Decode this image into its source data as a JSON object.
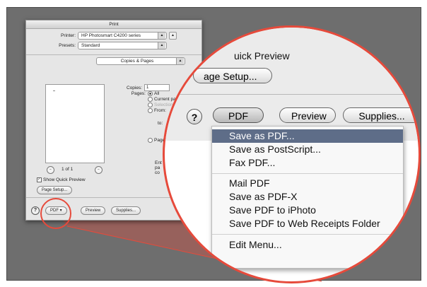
{
  "dialog": {
    "title": "Print",
    "printer_label": "Printer:",
    "printer_value": "HP Photosmart C4200 series",
    "presets_label": "Presets:",
    "presets_value": "Standard",
    "pane_value": "Copies & Pages",
    "copies_label": "Copies:",
    "copies_value": "1",
    "pages_label": "Pages:",
    "pages_all": "All",
    "pages_current": "Current page",
    "pages_selection": "Selection",
    "pages_from": "From:",
    "pages_to": "to:",
    "pages_range": "Page",
    "nav_text": "1 of 1",
    "show_quick_preview": "Show Quick Preview",
    "page_setup": "Page Setup...",
    "enter_text_1": "Ent",
    "enter_text_2": "pa",
    "enter_text_3": "co",
    "pdf_button": "PDF ▾",
    "preview_button": "Preview",
    "supplies_button": "Supplies...",
    "help": "?"
  },
  "lens": {
    "quick_preview": "uick Preview",
    "page_setup": "age Setup...",
    "help": "?",
    "pdf_button": "PDF ▾",
    "preview_button": "Preview",
    "supplies_button": "Supplies..."
  },
  "pdf_menu": {
    "items": [
      "Save as PDF...",
      "Save as PostScript...",
      "Fax PDF...",
      "Mail PDF",
      "Save as PDF-X",
      "Save PDF to iPhoto",
      "Save PDF to Web Receipts Folder",
      "Edit Menu..."
    ]
  },
  "colors": {
    "accent_red": "#e64a3b",
    "menu_highlight": "#5e6d88",
    "backdrop_gray": "#6e6e6e"
  }
}
